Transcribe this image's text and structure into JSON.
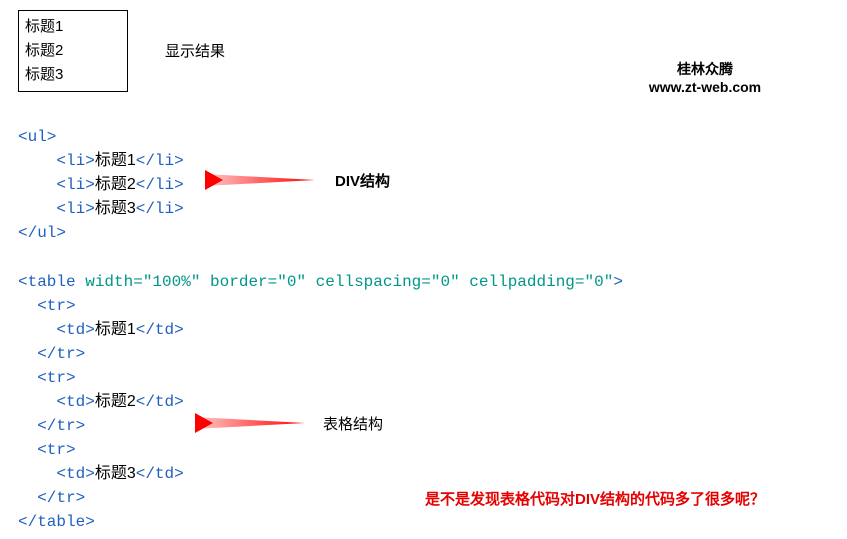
{
  "top_box": {
    "items": [
      "标题1",
      "标题2",
      "标题3"
    ]
  },
  "display_label": "显示结果",
  "brand": {
    "name": "桂林众腾",
    "url": "www.zt-web.com"
  },
  "code_ul": {
    "open": "<ul>",
    "li_open": "<li>",
    "li_close": "</li>",
    "items": [
      "标题1",
      "标题2",
      "标题3"
    ],
    "close": "</ul>"
  },
  "code_table": {
    "open": "<table width=\"100%\" border=\"0\" cellspacing=\"0\" cellpadding=\"0\">",
    "tr_open": "<tr>",
    "td_open": "<td>",
    "td_close": "</td>",
    "tr_close": "</tr>",
    "items": [
      "标题1",
      "标题2",
      "标题3"
    ],
    "close": "</table>"
  },
  "label_ul": "DIV结构",
  "label_table": "表格结构",
  "bottom_note": "是不是发现表格代码对DIV结构的代码多了很多呢？"
}
